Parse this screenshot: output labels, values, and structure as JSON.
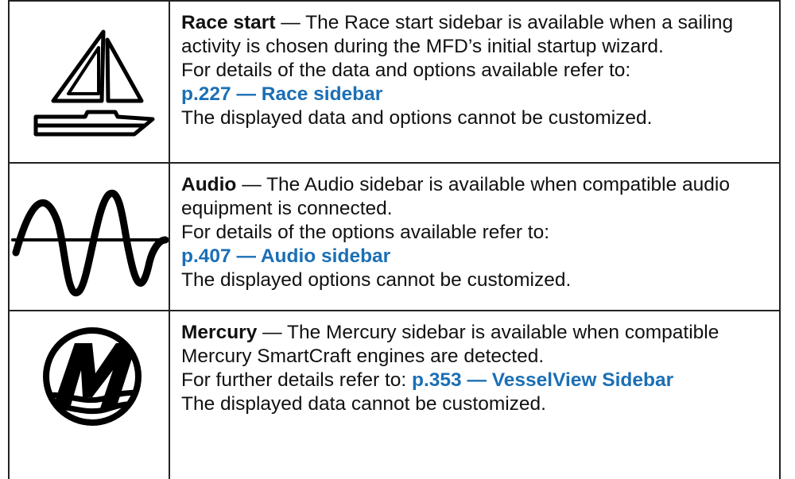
{
  "rows": [
    {
      "icon": "sailboat-icon",
      "title": "Race start",
      "dash": " — ",
      "description": "The Race start sidebar is available when a sailing activity is chosen during the MFD’s initial startup wizard.",
      "refer": "For details of the data and options available refer to:",
      "link": "p.227 — Race sidebar",
      "note": "The displayed data and options cannot be customized."
    },
    {
      "icon": "audio-wave-icon",
      "title": "Audio",
      "dash": " — ",
      "description": "The Audio sidebar is available when compatible audio equipment is connected.",
      "refer": "For details of the options available refer to:",
      "link": "p.407 — Audio sidebar",
      "note": "The displayed options cannot be customized."
    },
    {
      "icon": "mercury-logo-icon",
      "title": "Mercury",
      "dash": " — ",
      "description": "The Mercury sidebar is available when compatible Mercury SmartCraft engines are detected.",
      "refer": "For further details refer to: ",
      "link": "p.353 — VesselView Sidebar",
      "note": "The displayed data cannot be customized."
    }
  ],
  "colors": {
    "link": "#1b6fb5",
    "border": "#222222"
  }
}
